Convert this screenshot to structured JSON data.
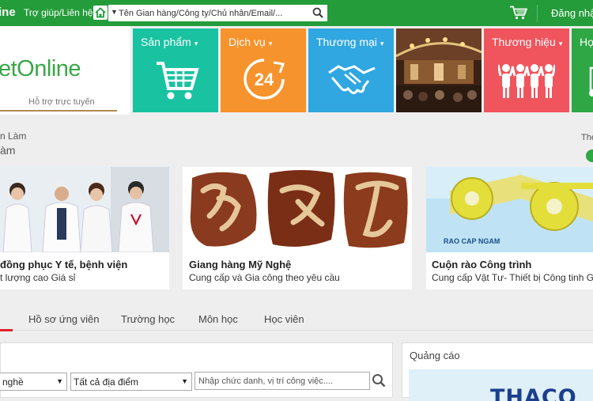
{
  "topbar": {
    "brand": "ine",
    "help_link": "Trợ giúp/Liên hệ",
    "search_placeholder": "Tên Gian hàng/Công ty/Chủ nhân/Email/...",
    "login_label": "Đăng nhập",
    "bg_color": "#259c3a"
  },
  "logo": {
    "text": "etOnline",
    "support": "Hỗ trợ trực tuyến"
  },
  "tiles": [
    {
      "label": "Sản phẩm",
      "icon": "cart-icon",
      "color": "#19c2a1"
    },
    {
      "label": "Dịch vụ",
      "icon": "clock-24-icon",
      "color": "#f7932c"
    },
    {
      "label": "Thương mại",
      "icon": "handshake-icon",
      "color": "#30a7e0"
    },
    {
      "label": "",
      "icon": "carousel-photo",
      "color": "#4a2a18"
    },
    {
      "label": "Thương hiệu",
      "icon": "people-icon",
      "color": "#f0545c"
    },
    {
      "label": "Họ",
      "icon": "board-icon",
      "color": "#2ea744"
    }
  ],
  "category": {
    "line1": "n Làm",
    "line2": "àm",
    "right_label": "Thé"
  },
  "cards": [
    {
      "title": "đồng phục Y tế, bệnh viện",
      "subtitle": "t lượng cao Giá sỉ"
    },
    {
      "title": "Giang hàng Mỹ Nghệ",
      "subtitle": "Cung cấp và Gia công theo yêu cầu"
    },
    {
      "title": "Cuộn rào Công trình",
      "subtitle": "Cung cấp Vật Tư- Thiết bị Công tinh G",
      "image_caption": "RAO CAP NGAM"
    }
  ],
  "tabs": [
    "Hồ sơ ứng viên",
    "Trường học",
    "Môn học",
    "Học viên"
  ],
  "filter": {
    "select1": "nghề",
    "select2": "Tất cả địa điểm",
    "keyword_placeholder": "Nhập chức danh, vị trí công việc...."
  },
  "ads": {
    "title": "Quảng cáo",
    "brand": "THACO"
  }
}
